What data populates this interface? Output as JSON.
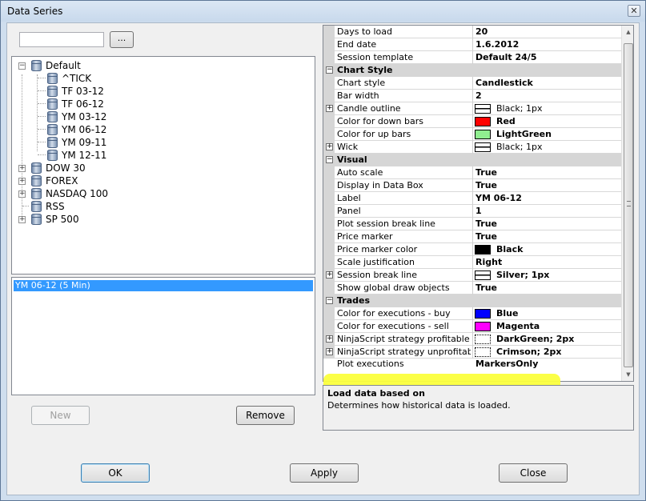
{
  "window": {
    "title": "Data Series",
    "close_glyph": "✕"
  },
  "search": {
    "value": "",
    "browse_label": "..."
  },
  "tree": {
    "root": "Default",
    "children": [
      "^TICK",
      "TF 03-12",
      "TF 06-12",
      "YM 03-12",
      "YM 06-12",
      "YM 09-11",
      "YM 12-11"
    ],
    "groups": [
      "DOW 30",
      "FOREX",
      "NASDAQ 100",
      "RSS",
      "SP 500"
    ]
  },
  "series_list": {
    "selected": "YM 06-12 (5 Min)"
  },
  "buttons": {
    "new": "New",
    "remove": "Remove",
    "ok": "OK",
    "apply": "Apply",
    "close": "Close"
  },
  "properties": {
    "rows": [
      {
        "name": "Days to load",
        "value": "20"
      },
      {
        "name": "End date",
        "value": "1.6.2012"
      },
      {
        "name": "Session template",
        "value": "Default 24/5"
      }
    ],
    "chart_style": {
      "title": "Chart Style",
      "rows": [
        {
          "name": "Chart style",
          "value": "Candlestick"
        },
        {
          "name": "Bar width",
          "value": "2"
        },
        {
          "name": "Candle outline",
          "value": "Black; 1px"
        },
        {
          "name": "Color for down bars",
          "value": "Red",
          "color": "#ff0000"
        },
        {
          "name": "Color for up bars",
          "value": "LightGreen",
          "color": "#90ee90"
        },
        {
          "name": "Wick",
          "value": "Black; 1px"
        }
      ]
    },
    "visual": {
      "title": "Visual",
      "rows": [
        {
          "name": "Auto scale",
          "value": "True"
        },
        {
          "name": "Display in Data Box",
          "value": "True"
        },
        {
          "name": "Label",
          "value": "YM 06-12"
        },
        {
          "name": "Panel",
          "value": "1"
        },
        {
          "name": "Plot session break line",
          "value": "True"
        },
        {
          "name": "Price marker",
          "value": "True"
        },
        {
          "name": "Price marker color",
          "value": "Black",
          "color": "#000000"
        },
        {
          "name": "Scale justification",
          "value": "Right"
        },
        {
          "name": "Session break line",
          "value": "Silver; 1px"
        },
        {
          "name": "Show global draw objects",
          "value": "True"
        }
      ]
    },
    "trades": {
      "title": "Trades",
      "rows": [
        {
          "name": "Color for executions - buy",
          "value": "Blue",
          "color": "#0000ff"
        },
        {
          "name": "Color for executions - sell",
          "value": "Magenta",
          "color": "#ff00ff"
        },
        {
          "name": "NinjaScript strategy profitable trac",
          "value": "DarkGreen; 2px"
        },
        {
          "name": "NinjaScript strategy unprofitable tr",
          "value": "Crimson; 2px"
        },
        {
          "name": "Plot executions",
          "value": "MarkersOnly"
        }
      ]
    }
  },
  "description": {
    "title": "Load data based on",
    "text": "Determines how historical data is loaded."
  },
  "colors": {
    "highlight": "#fbff3d",
    "selection": "#3399ff"
  }
}
